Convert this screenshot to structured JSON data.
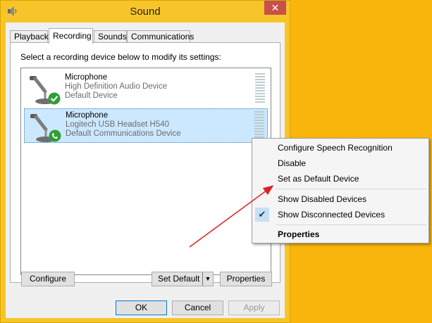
{
  "window": {
    "title": "Sound",
    "close_glyph": "✕"
  },
  "tabs": [
    {
      "label": "Playback"
    },
    {
      "label": "Recording"
    },
    {
      "label": "Sounds"
    },
    {
      "label": "Communications"
    }
  ],
  "recording": {
    "instructions": "Select a recording device below to modify its settings:",
    "devices": [
      {
        "name": "Microphone",
        "line2": "High Definition Audio Device",
        "line3": "Default Device",
        "badge": "check-badge-icon"
      },
      {
        "name": "Microphone",
        "line2": "Logitech USB Headset H540",
        "line3": "Default Communications Device",
        "badge": "phone-badge-icon"
      }
    ]
  },
  "buttons": {
    "configure": "Configure",
    "set_default": "Set Default",
    "properties": "Properties",
    "ok": "OK",
    "cancel": "Cancel",
    "apply": "Apply"
  },
  "context_menu": {
    "items": [
      {
        "label": "Configure Speech Recognition"
      },
      {
        "label": "Disable"
      },
      {
        "label": "Set as Default Device"
      },
      {
        "label": "Show Disabled Devices"
      },
      {
        "label": "Show Disconnected Devices"
      },
      {
        "label": "Properties"
      }
    ],
    "check_glyph": "✔"
  },
  "colors": {
    "desktop": "#f9b50b",
    "close_button": "#c7504a",
    "selection": "#cce8ff",
    "annotation_arrow": "#e02020"
  }
}
